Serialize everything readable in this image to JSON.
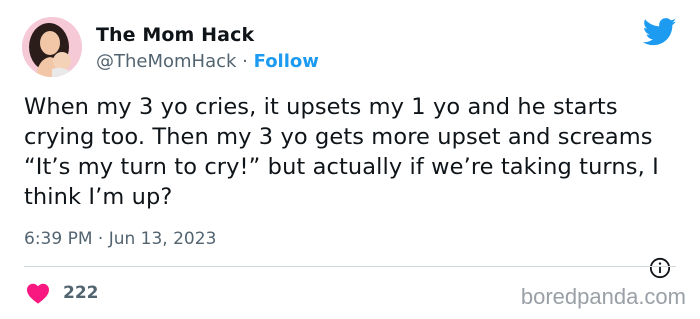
{
  "author": {
    "name": "The Mom Hack",
    "handle": "@TheMomHack",
    "separator": " · ",
    "follow_label": "Follow"
  },
  "tweet": {
    "text": "When my 3 yo cries, it upsets my 1 yo and he starts crying too. Then my 3 yo gets more upset and screams “It’s my turn to cry!” but actually if we’re taking turns, I think I’m up?",
    "timestamp": "6:39 PM · Jun 13, 2023"
  },
  "engagement": {
    "like_count": "222"
  },
  "watermark": "boredpanda.com",
  "icons": {
    "brand": "twitter-bird-icon",
    "info": "info-icon",
    "like": "heart-icon"
  },
  "colors": {
    "link": "#1d9bf0",
    "heart": "#f91880",
    "muted_text": "#536471"
  }
}
